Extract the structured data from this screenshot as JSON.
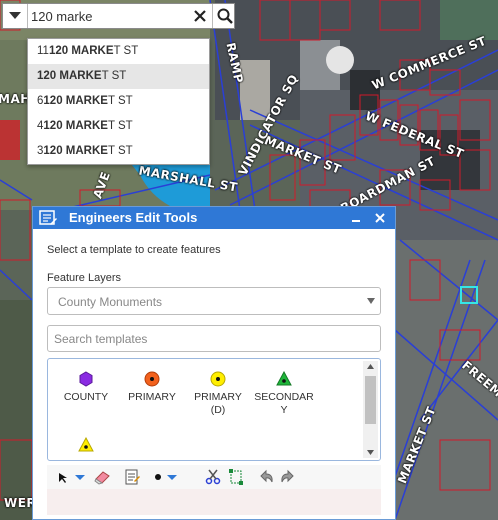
{
  "map": {
    "street_labels": [
      "W COMMERCE ST",
      "W FEDERAL ST",
      "MARKET ST",
      "MARSHALL ST",
      "VINDICATOR SQ",
      "W BOARDMAN ST",
      "RAMP",
      "MAHO",
      "AVE",
      "FREEM",
      "MARKET ST",
      "WER"
    ],
    "colors": {
      "parcel": "#d11a2a",
      "road": "#2a3fd6",
      "water": "#1e9bd8",
      "selection": "#35e6e6"
    }
  },
  "search": {
    "query": "120 marke",
    "dropdown_icon": "triangle-down-icon",
    "clear_icon": "close-icon",
    "search_icon": "search-icon"
  },
  "suggestions": [
    {
      "prefix": "11",
      "match": "120 MARKE",
      "suffix": "T ST"
    },
    {
      "prefix": "",
      "match": "120 MARKE",
      "suffix": "T ST"
    },
    {
      "prefix": "6",
      "match": "120 MARKE",
      "suffix": "T ST"
    },
    {
      "prefix": "4",
      "match": "120 MARKE",
      "suffix": "T ST"
    },
    {
      "prefix": "3",
      "match": "120 MARKE",
      "suffix": "T ST"
    }
  ],
  "panel": {
    "title": "Engineers Edit Tools",
    "colors": {
      "titlebar": "#2f78d6",
      "border": "#6a9bd6"
    },
    "instruction": "Select a template to create features",
    "feature_layers_label": "Feature Layers",
    "selected_layer": "County Monuments",
    "template_search_placeholder": "Search templates",
    "templates": [
      {
        "label1": "COUNTY",
        "label2": "",
        "icon": "purple-hexagon-icon"
      },
      {
        "label1": "PRIMARY",
        "label2": "",
        "icon": "orange-circle-icon"
      },
      {
        "label1": "PRIMARY",
        "label2": "(D)",
        "icon": "yellow-circle-icon"
      },
      {
        "label1": "SECONDAR",
        "label2": "Y",
        "icon": "green-triangle-icon"
      },
      {
        "label1": "",
        "label2": "",
        "icon": "yellow-triangle-icon"
      }
    ],
    "toolbar_icons": [
      "select-arrow-icon",
      "dropdown-icon",
      "eraser-icon",
      "attributes-icon",
      "point-icon",
      "dropdown-icon",
      "cut-icon",
      "reshape-icon",
      "undo-icon",
      "redo-icon"
    ]
  }
}
